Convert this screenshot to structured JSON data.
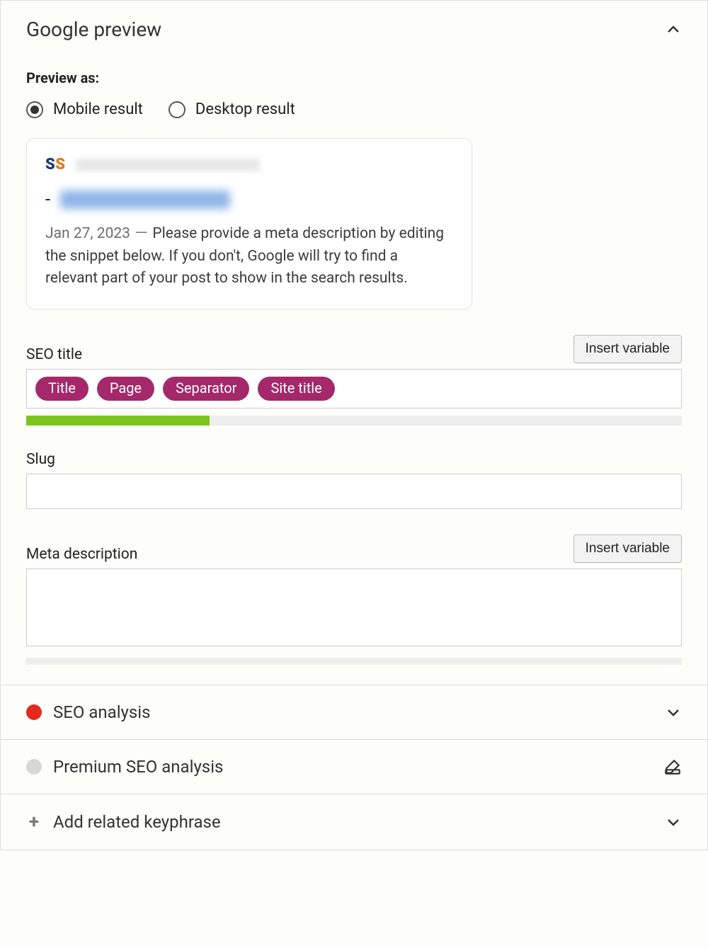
{
  "header": {
    "title": "Google preview"
  },
  "preview_as": {
    "label": "Preview as:",
    "options": [
      {
        "label": "Mobile result",
        "selected": true
      },
      {
        "label": "Desktop result",
        "selected": false
      }
    ]
  },
  "preview_card": {
    "logo_text_1": "S",
    "logo_text_2": "S",
    "dash": "-",
    "date": "Jan 27, 2023",
    "sep": "－",
    "description": "Please provide a meta description by editing the snippet below. If you don't, Google will try to find a relevant part of your post to show in the search results."
  },
  "seo_title": {
    "label": "SEO title",
    "insert_btn": "Insert variable",
    "chips": [
      "Title",
      "Page",
      "Separator",
      "Site title"
    ],
    "progress_pct": 28
  },
  "slug": {
    "label": "Slug",
    "value": ""
  },
  "meta_desc": {
    "label": "Meta description",
    "insert_btn": "Insert variable",
    "value": ""
  },
  "accordion": {
    "seo_analysis": "SEO analysis",
    "premium": "Premium SEO analysis",
    "related": "Add related keyphrase"
  }
}
